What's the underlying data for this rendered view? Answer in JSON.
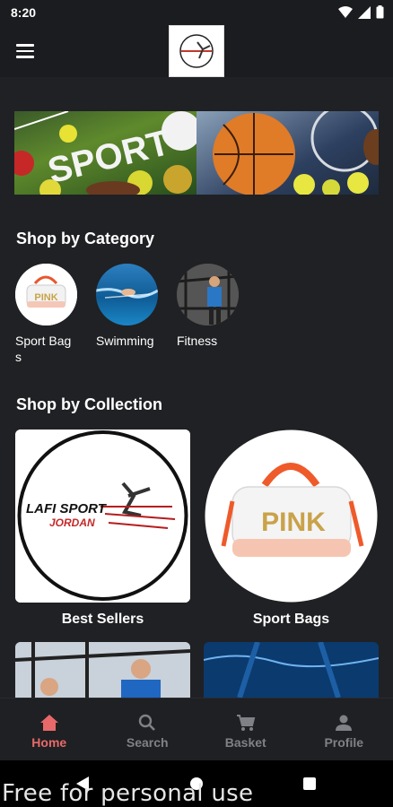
{
  "status_bar": {
    "time": "8:20"
  },
  "header": {
    "menu_icon": "menu-icon",
    "logo": "lafi-sport-logo"
  },
  "sections": {
    "category_title": "Shop by Category",
    "collection_title": "Shop by Collection"
  },
  "categories": [
    {
      "label": "Sport Bags",
      "image_text": "PINK"
    },
    {
      "label": "Swimming",
      "image_text": ""
    },
    {
      "label": "Fitness",
      "image_text": ""
    }
  ],
  "collections": [
    {
      "label": "Best Sellers",
      "logo_line1": "LAFI SPORT",
      "logo_line2": "JORDAN"
    },
    {
      "label": "Sport Bags",
      "bag_text": "PINK"
    }
  ],
  "banner": {
    "text": "SPORT"
  },
  "bottom_nav": [
    {
      "label": "Home",
      "icon": "home-icon",
      "active": true
    },
    {
      "label": "Search",
      "icon": "search-icon",
      "active": false
    },
    {
      "label": "Basket",
      "icon": "cart-icon",
      "active": false
    },
    {
      "label": "Profile",
      "icon": "person-icon",
      "active": false
    }
  ],
  "watermark": "Free for personal use",
  "colors": {
    "background": "#202124",
    "accent": "#e8696a",
    "inactive": "#7f8186"
  }
}
